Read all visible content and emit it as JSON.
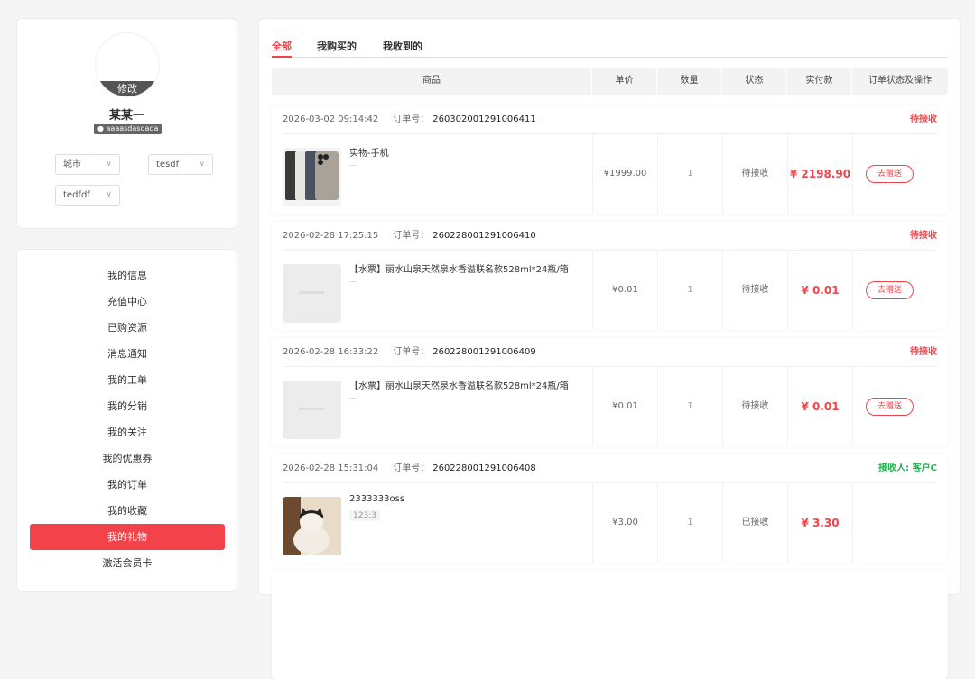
{
  "profile": {
    "avatar_edit": "修改",
    "name": "某某一",
    "user_id": "aaaasdasdada",
    "selects": [
      "城市",
      "tesdf",
      "tedfdf"
    ]
  },
  "menu": [
    "我的信息",
    "充值中心",
    "已购资源",
    "消息通知",
    "我的工单",
    "我的分销",
    "我的关注",
    "我的优惠券",
    "我的订单",
    "我的收藏",
    "我的礼物",
    "激活会员卡"
  ],
  "menu_active": 10,
  "tabs": [
    "全部",
    "我购买的",
    "我收到的"
  ],
  "columns": [
    "商品",
    "单价",
    "数量",
    "状态",
    "实付款",
    "订单状态及操作"
  ],
  "order_no_label": "订单号：",
  "colors": {
    "accent": "#f2434a",
    "green": "#22b14c"
  },
  "orders": [
    {
      "time": "2026-03-02 09:14:42",
      "no": "260302001291006411",
      "status": "待接收",
      "product": "实物-手机",
      "tag": "",
      "price": "¥1999.00",
      "qty": "1",
      "state": "待接收",
      "paid": "¥ 2198.90",
      "action": "去赠送",
      "img": "phone"
    },
    {
      "time": "2026-02-28 17:25:15",
      "no": "260228001291006410",
      "status": "待接收",
      "product": "【水票】丽水山泉天然泉水香溢联名款528ml*24瓶/箱",
      "tag": "",
      "price": "¥0.01",
      "qty": "1",
      "state": "待接收",
      "paid": "¥ 0.01",
      "action": "去赠送",
      "img": "blank"
    },
    {
      "time": "2026-02-28 16:33:22",
      "no": "260228001291006409",
      "status": "待接收",
      "product": "【水票】丽水山泉天然泉水香溢联名款528ml*24瓶/箱",
      "tag": "",
      "price": "¥0.01",
      "qty": "1",
      "state": "待接收",
      "paid": "¥ 0.01",
      "action": "去赠送",
      "img": "blank"
    },
    {
      "time": "2026-02-28 15:31:04",
      "no": "260228001291006408",
      "status": "接收人: 客户C",
      "product": "2333333oss",
      "tag": "123:3",
      "price": "¥3.00",
      "qty": "1",
      "state": "已接收",
      "paid": "¥ 3.30",
      "action": "",
      "img": "cat"
    }
  ]
}
